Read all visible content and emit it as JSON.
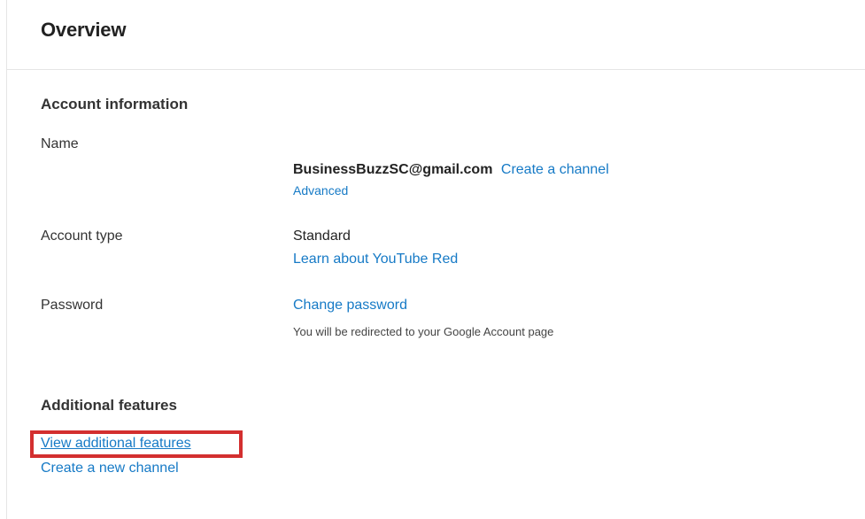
{
  "header": {
    "title": "Overview"
  },
  "account_information": {
    "heading": "Account information",
    "name": {
      "label": "Name",
      "email": "BusinessBuzzSC@gmail.com",
      "create_channel_link": "Create a channel",
      "advanced_link": "Advanced"
    },
    "account_type": {
      "label": "Account type",
      "value": "Standard",
      "learn_link": "Learn about YouTube Red"
    },
    "password": {
      "label": "Password",
      "change_link": "Change password",
      "note": "You will be redirected to your Google Account page"
    }
  },
  "additional_features": {
    "heading": "Additional features",
    "view_link": "View additional features",
    "new_channel_link": "Create a new channel"
  },
  "colors": {
    "link": "#167ac6",
    "highlight": "#d32f2f",
    "divider": "#e5e5e5"
  }
}
